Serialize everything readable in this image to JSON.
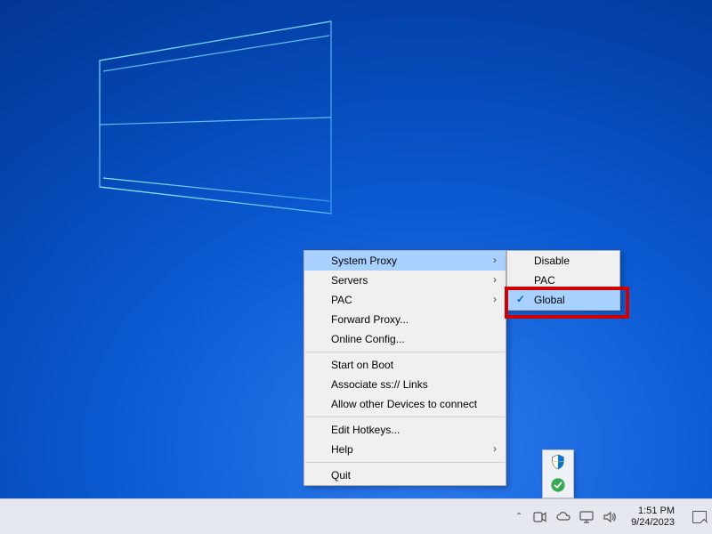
{
  "main_menu": {
    "system_proxy": "System Proxy",
    "servers": "Servers",
    "pac": "PAC",
    "forward_proxy": "Forward Proxy...",
    "online_config": "Online Config...",
    "start_on_boot": "Start on Boot",
    "associate_links": "Associate ss:// Links",
    "allow_other": "Allow other Devices to connect",
    "edit_hotkeys": "Edit Hotkeys...",
    "help": "Help",
    "quit": "Quit"
  },
  "sub_menu": {
    "disable": "Disable",
    "pac": "PAC",
    "global": "Global"
  },
  "clock": {
    "time": "1:51 PM",
    "date": "9/24/2023"
  },
  "colors": {
    "highlight": "#a8d1ff",
    "annotation": "#d00000",
    "accent": "#0066cc"
  }
}
